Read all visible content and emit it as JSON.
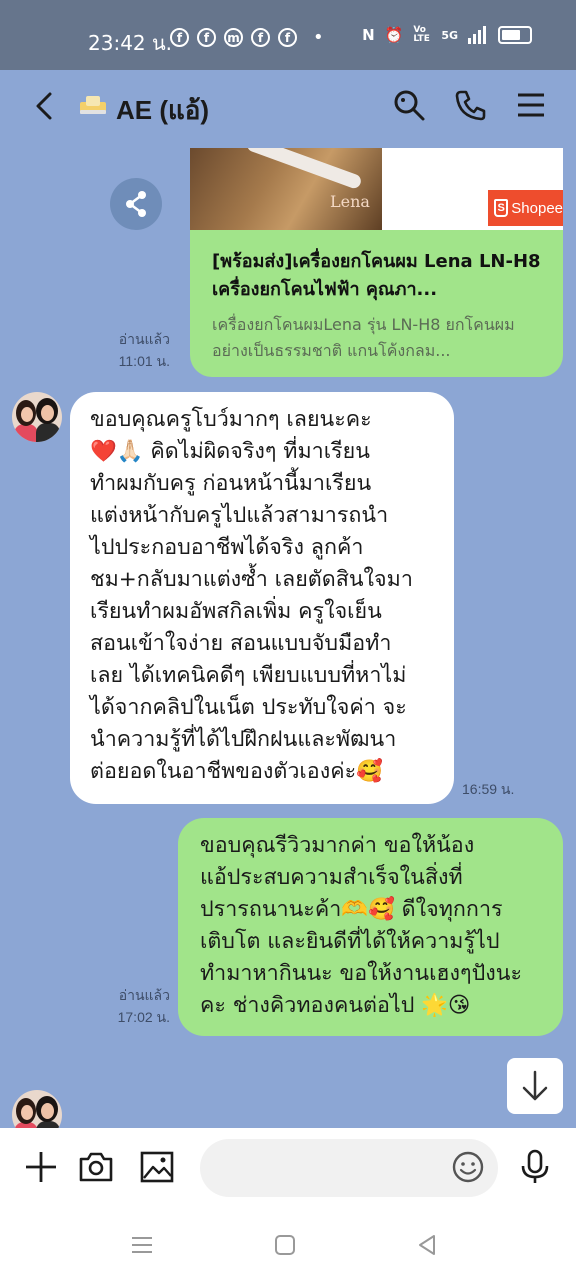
{
  "status_bar": {
    "time": "23:42 น.",
    "network": "5G",
    "volte": "Vo LTE"
  },
  "header": {
    "title": "AE (แอ้)"
  },
  "messages": [
    {
      "type": "link",
      "side": "right",
      "image_brand": "Lena",
      "image_store": "Shopee",
      "title": "[พร้อมส่ง]เครื่องยกโคนผม Lena LN-H8 เครื่องยกโคนไฟฟ้า คุณภา...",
      "description": "เครื่องยกโคนผมLena รุ่น LN-H8 ยกโคนผมอย่างเป็นธรรมชาติ แกนโค้งกลม...",
      "read": "อ่านแล้ว",
      "time": "11:01 น."
    },
    {
      "type": "text",
      "side": "left",
      "text_lines": [
        "ขอบคุณครูโบว์มากๆ เลยนะคะ",
        "❤️🙏🏻 คิดไม่ผิดจริงๆ ที่มาเรียน",
        "ทำผมกับครู ก่อนหน้านี้มาเรียน",
        "แต่งหน้ากับครูไปแล้วสามารถนำ",
        "ไปประกอบอาชีพได้จริง ลูกค้า",
        "ชม+กลับมาแต่งซ้ำ เลยตัดสินใจมา",
        "เรียนทำผมอัพสกิลเพิ่ม ครูใจเย็น",
        "สอนเข้าใจง่าย สอนแบบจับมือทำ",
        "เลย ได้เทคนิคดีๆ เพียบแบบที่หาไม่",
        "ได้จากคลิปในเน็ต ประทับใจค่า จะ",
        "นำความรู้ที่ได้ไปฝึกฝนและพัฒนา",
        "ต่อยอดในอาชีพของตัวเองค่ะ🥰"
      ],
      "time": "16:59 น."
    },
    {
      "type": "text",
      "side": "right",
      "text_lines": [
        "ขอบคุณรีวิวมากค่า ขอให้น้อง",
        "แอ้ประสบความสำเร็จในสิ่งที่",
        "ปรารถนานะค้า🫶🥰 ดีใจทุกการ",
        "เติบโต และยินดีที่ได้ให้ความรู้ไป",
        "ทำมาหากินนะ ขอให้งานเฮงๆปังนะ",
        "คะ ช่างคิวทองคนต่อไป 🌟😘"
      ],
      "read": "อ่านแล้ว",
      "time": "17:02 น."
    }
  ],
  "input": {
    "placeholder": ""
  },
  "colors": {
    "chat_background": "#8ca6d4",
    "my_bubble": "#a1e48a",
    "their_bubble": "#ffffff",
    "status_bar": "#66758c"
  }
}
